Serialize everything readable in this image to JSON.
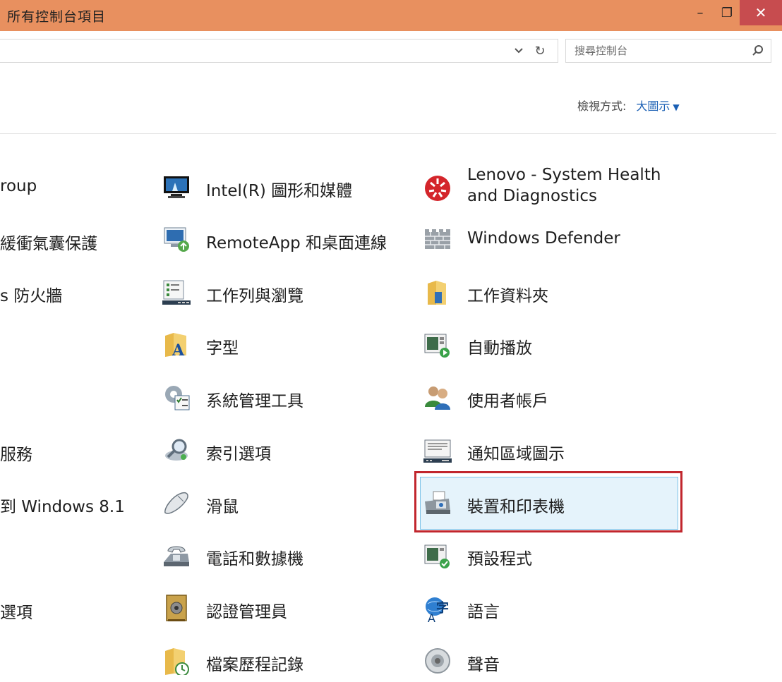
{
  "window": {
    "title": "所有控制台項目",
    "minimize_glyph": "–",
    "maximize_glyph": "❐",
    "close_glyph": "✕"
  },
  "address_bar": {
    "dropdown_icon": "chevron-down-icon",
    "refresh_icon": "refresh-icon",
    "refresh_glyph": "↻"
  },
  "search": {
    "placeholder": "搜尋控制台",
    "icon": "search-icon"
  },
  "view": {
    "label": "檢視方式:",
    "value": "大圖示",
    "caret": "▼"
  },
  "column_left_partial": [
    "roup",
    "緩衝氣囊保護",
    "s 防火牆",
    "服務",
    "到 Windows 8.1",
    "選項"
  ],
  "column_middle": [
    {
      "label": "Intel(R) 圖形和媒體",
      "icon": "monitor-icon"
    },
    {
      "label": "RemoteApp 和桌面連線",
      "icon": "remote-desktop-icon"
    },
    {
      "label": "工作列與瀏覽",
      "icon": "taskbar-icon"
    },
    {
      "label": "字型",
      "icon": "font-folder-icon"
    },
    {
      "label": "系統管理工具",
      "icon": "admin-tools-icon"
    },
    {
      "label": "索引選項",
      "icon": "indexing-icon"
    },
    {
      "label": "滑鼠",
      "icon": "mouse-icon"
    },
    {
      "label": "電話和數據機",
      "icon": "phone-modem-icon"
    },
    {
      "label": "認證管理員",
      "icon": "credential-vault-icon"
    },
    {
      "label": "檔案歷程記錄",
      "icon": "file-history-icon"
    }
  ],
  "column_right": [
    {
      "label_line1": "Lenovo - System Health",
      "label_line2": "and Diagnostics",
      "icon": "lenovo-health-icon"
    },
    {
      "label": "Windows Defender",
      "icon": "wall-icon"
    },
    {
      "label": "工作資料夾",
      "icon": "work-folders-icon"
    },
    {
      "label": "自動播放",
      "icon": "autoplay-icon"
    },
    {
      "label": "使用者帳戶",
      "icon": "users-icon"
    },
    {
      "label": "通知區域圖示",
      "icon": "notification-icon"
    },
    {
      "label": "裝置和印表機",
      "icon": "printer-icon",
      "selected": true
    },
    {
      "label": "預設程式",
      "icon": "default-programs-icon"
    },
    {
      "label": "語言",
      "icon": "language-icon"
    },
    {
      "label": "聲音",
      "icon": "speaker-icon"
    }
  ],
  "colors": {
    "title_bar": "#e8905f",
    "close_button": "#c74c4f",
    "link_blue": "#1a5fb4",
    "selection_fill": "#e5f3fb",
    "selection_border": "#7cc3e9",
    "highlight_frame": "#c1262d"
  }
}
